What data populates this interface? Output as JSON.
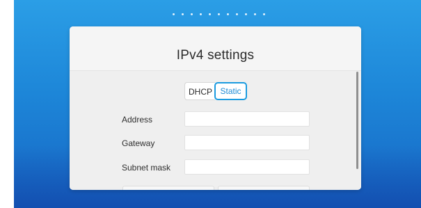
{
  "screen": {
    "pagination_dots": 11
  },
  "dialog": {
    "title": "IPv4 settings",
    "mode_toggle": {
      "options": [
        "DHCP",
        "Static"
      ],
      "selected": "Static"
    },
    "fields": [
      {
        "label": "Address",
        "value": ""
      },
      {
        "label": "Gateway",
        "value": ""
      },
      {
        "label": "Subnet mask",
        "value": ""
      }
    ]
  },
  "colors": {
    "accent": "#1a9be0",
    "background_top": "#2b9ee6",
    "background_bottom": "#1766c4"
  }
}
